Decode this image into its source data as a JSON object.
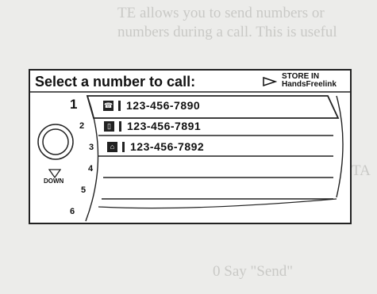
{
  "background_text": {
    "line1": "TE allows you to send numbers or",
    "line2": "numbers during a call. This is useful",
    "line3": "TA",
    "line4": "0 Say \"Send\""
  },
  "screen": {
    "title": "Select a number to call:",
    "store_line1": "STORE IN",
    "store_line2": "HandsFreelink",
    "down_label": "DOWN",
    "row_numbers": [
      "1",
      "2",
      "3",
      "4",
      "5",
      "6"
    ],
    "entries": [
      {
        "number": "123-456-7890",
        "icon": "phone-book-icon"
      },
      {
        "number": "123-456-7891",
        "icon": "mobile-phone-icon"
      },
      {
        "number": "123-456-7892",
        "icon": "home-phone-icon"
      }
    ]
  }
}
